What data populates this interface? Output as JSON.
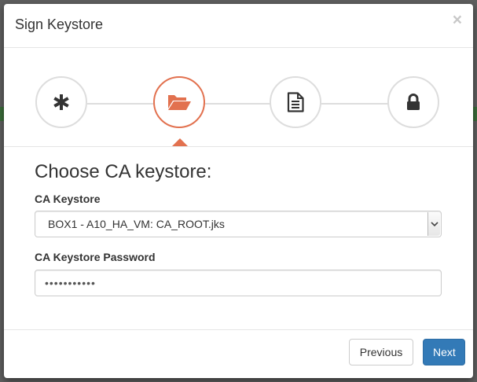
{
  "modal": {
    "title": "Sign Keystore",
    "close_label": "×"
  },
  "wizard": {
    "steps": [
      {
        "icon": "asterisk-icon",
        "state": "done"
      },
      {
        "icon": "folder-open-icon",
        "state": "active"
      },
      {
        "icon": "document-icon",
        "state": "pending"
      },
      {
        "icon": "lock-icon",
        "state": "pending"
      }
    ],
    "colors": {
      "active": "#e2714f",
      "inactive": "#dddddd",
      "icon": "#333333"
    }
  },
  "form": {
    "section_title": "Choose CA keystore:",
    "keystore_label": "CA Keystore",
    "keystore_value": "BOX1 - A10_HA_VM: CA_ROOT.jks",
    "password_label": "CA Keystore Password",
    "password_value": "•••••••••••"
  },
  "footer": {
    "previous_label": "Previous",
    "next_label": "Next",
    "next_color": "#337ab7"
  }
}
